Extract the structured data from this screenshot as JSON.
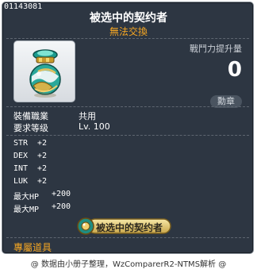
{
  "item": {
    "id": "01143081",
    "name": "被选中的契约者",
    "trade_status": "無法交換",
    "icon_name": "orb-jar-icon"
  },
  "power": {
    "label": "戰鬥力提升量",
    "value": "0",
    "button_label": "勳章"
  },
  "requirements": [
    {
      "label": "裝備職業",
      "value": "共用"
    },
    {
      "label": "要求等级",
      "value": "Lv. 100"
    }
  ],
  "stats": [
    {
      "label": "STR",
      "value": "+2"
    },
    {
      "label": "DEX",
      "value": "+2"
    },
    {
      "label": "INT",
      "value": "+2"
    },
    {
      "label": "LUK",
      "value": "+2"
    },
    {
      "label": "最大HP",
      "value": "+200"
    },
    {
      "label": "最大MP",
      "value": "+200"
    }
  ],
  "medal_banner": "被选中的契约者",
  "exclusive_label": "專屬道具",
  "footer": "@ 数据由小册子整理，WzComparerR2-NTMS解析 @",
  "colors": {
    "panel_bg": "#2d3642",
    "panel_border": "#7f8790",
    "accent_orange": "#f5a623",
    "text_white": "#ffffff"
  }
}
